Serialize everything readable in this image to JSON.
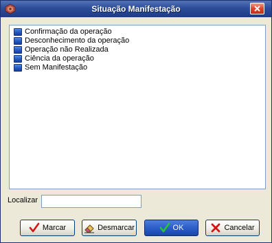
{
  "window": {
    "title": "Situação Manifestação"
  },
  "list": {
    "items": [
      {
        "label": "Confirmação da operação",
        "checked": true
      },
      {
        "label": "Desconhecimento da operação",
        "checked": true
      },
      {
        "label": "Operação não Realizada",
        "checked": true
      },
      {
        "label": "Ciência da operação",
        "checked": true
      },
      {
        "label": "Sem Manifestação",
        "checked": true
      }
    ]
  },
  "search": {
    "label": "Localizar",
    "value": "",
    "placeholder": ""
  },
  "buttons": {
    "check_all": "Marcar",
    "uncheck_all": "Desmarcar",
    "ok": "OK",
    "cancel": "Cancelar"
  },
  "icons": {
    "app": "app-logo-icon",
    "close": "close-icon",
    "check_all": "red-check-icon",
    "uncheck_all": "eraser-icon",
    "ok": "green-check-icon",
    "cancel": "red-x-icon"
  },
  "colors": {
    "titlebar": "#2d4d99",
    "checkbox": "#2457c2",
    "window_bg": "#ece9d8",
    "close_button": "#d9442a"
  }
}
